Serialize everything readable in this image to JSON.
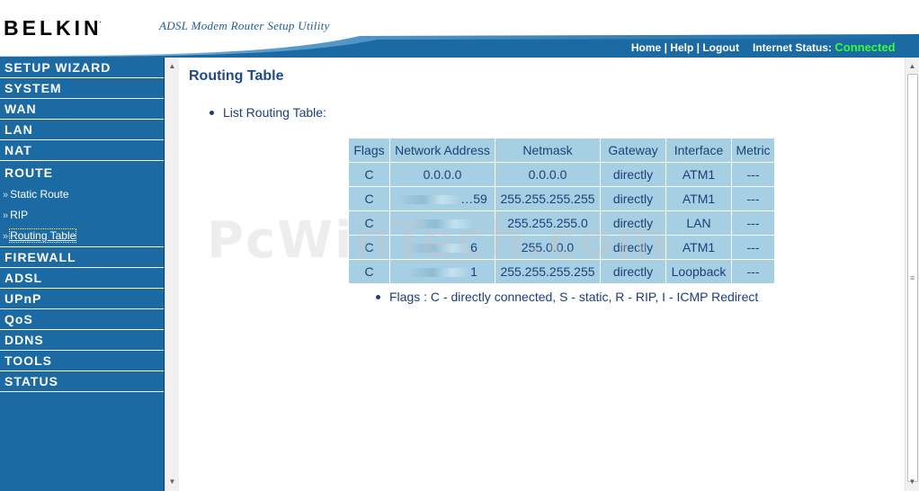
{
  "header": {
    "brand": "BELKIN",
    "brand_mark": ".",
    "subtitle": "ADSL Modem Router Setup Utility",
    "links": [
      "Home",
      "Help",
      "Logout"
    ],
    "separator": "|",
    "internet_status_label": "Internet Status:",
    "internet_status_value": "Connected",
    "colors": {
      "status_ok": "#33ff33",
      "bar": "#1b6aa3"
    }
  },
  "sidebar": {
    "items": [
      {
        "label": "SETUP WIZARD"
      },
      {
        "label": "SYSTEM"
      },
      {
        "label": "WAN"
      },
      {
        "label": "LAN"
      },
      {
        "label": "NAT"
      }
    ],
    "route": {
      "label": "ROUTE",
      "subitems": [
        {
          "label": "Static Route",
          "arrow": "»"
        },
        {
          "label": "RIP",
          "arrow": "»"
        },
        {
          "label": "Routing Table",
          "arrow": "»",
          "active": true
        }
      ]
    },
    "items_after": [
      {
        "label": "FIREWALL"
      },
      {
        "label": "ADSL"
      },
      {
        "label": "UPnP"
      },
      {
        "label": "QoS"
      },
      {
        "label": "DDNS"
      },
      {
        "label": "TOOLS"
      },
      {
        "label": "STATUS"
      }
    ]
  },
  "main": {
    "title": "Routing Table",
    "list_label": "List Routing Table:",
    "table": {
      "headers": [
        "Flags",
        "Network Address",
        "Netmask",
        "Gateway",
        "Interface",
        "Metric"
      ],
      "rows": [
        [
          "C",
          "0.0.0.0",
          "0.0.0.0",
          "directly",
          "ATM1",
          "---"
        ],
        [
          "C",
          "…59",
          "255.255.255.255",
          "directly",
          "ATM1",
          "---"
        ],
        [
          "C",
          "",
          "255.255.255.0",
          "directly",
          "LAN",
          "---"
        ],
        [
          "C",
          "6",
          "255.0.0.0",
          "directly",
          "ATM1",
          "---"
        ],
        [
          "C",
          "1",
          "255.255.255.255",
          "directly",
          "Loopback",
          "---"
        ]
      ]
    },
    "legend": "Flags :  C - directly connected, S - static, R - RIP, I - ICMP Redirect"
  },
  "watermark": "PcWinTech.com"
}
